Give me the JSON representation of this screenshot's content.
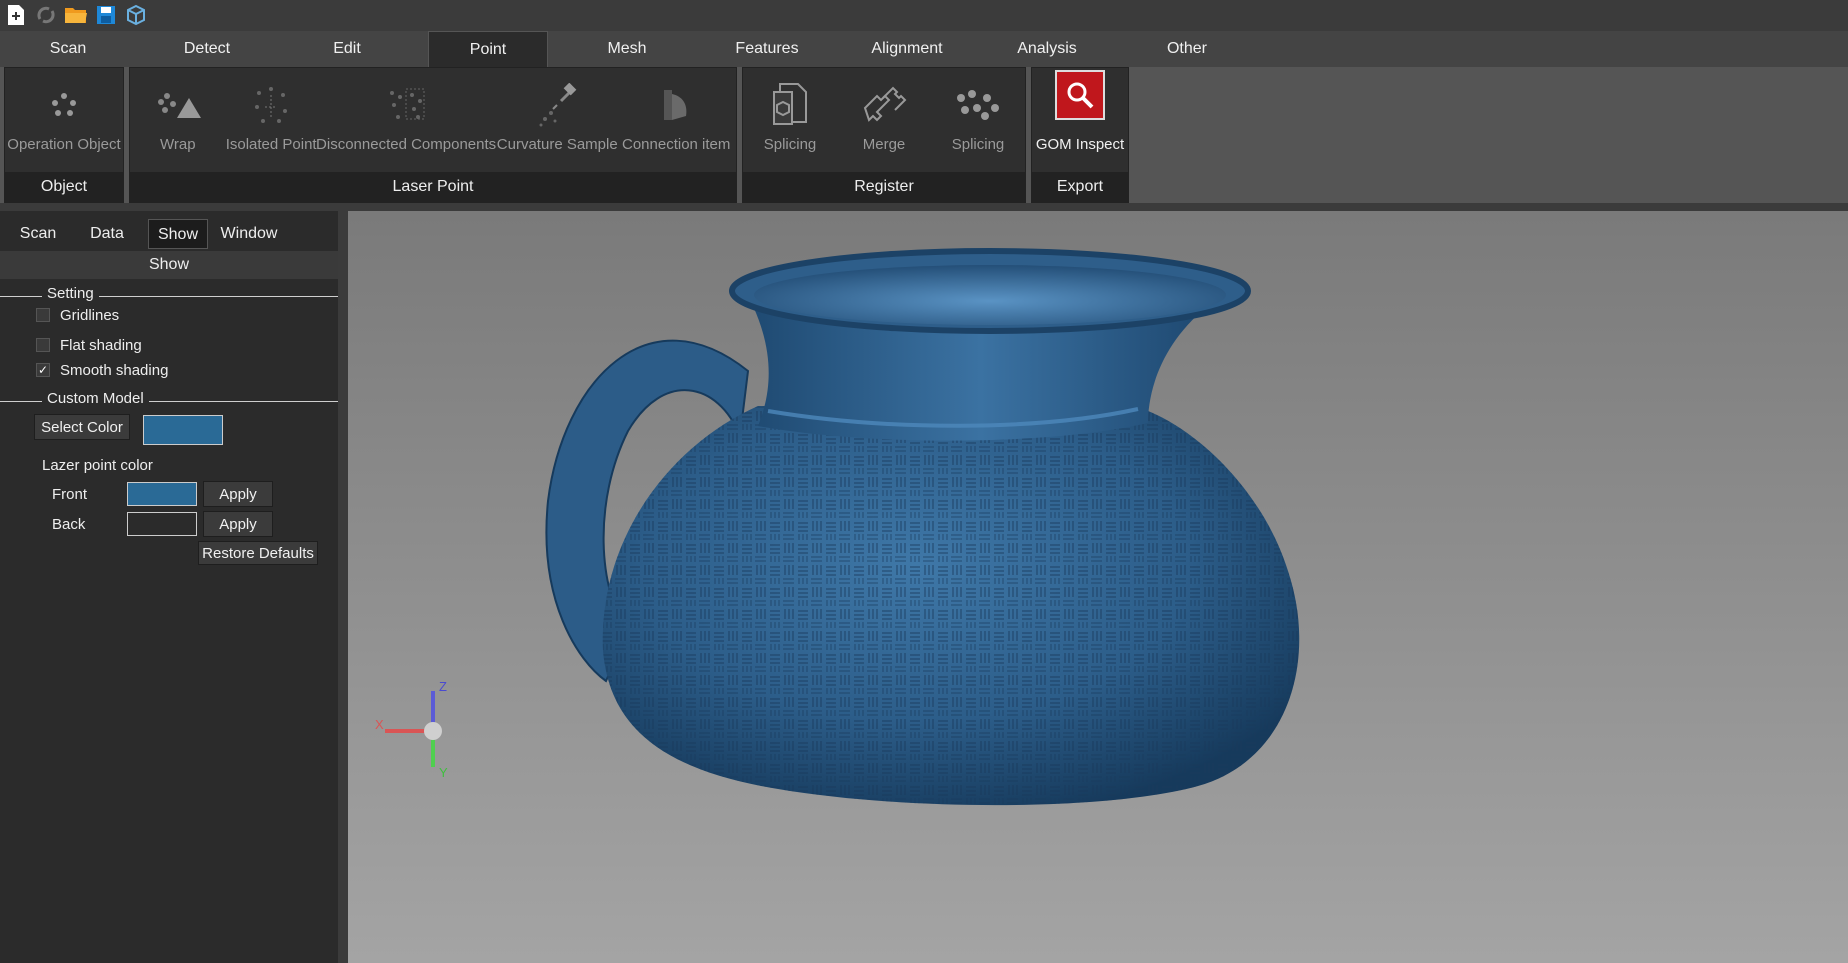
{
  "menu": {
    "tabs": [
      "Scan",
      "Detect",
      "Edit",
      "Point",
      "Mesh",
      "Features",
      "Alignment",
      "Analysis",
      "Other"
    ],
    "active": "Point"
  },
  "ribbon": {
    "object_group": {
      "label": "Object",
      "tools": {
        "operation_object": "Operation Object"
      }
    },
    "laser_group": {
      "label": "Laser Point",
      "tools": {
        "wrap": "Wrap",
        "isolated": "Isolated Point",
        "disconnected": "Disconnected Components",
        "curvature": "Curvature Sample",
        "connection": "Connection item"
      }
    },
    "register_group": {
      "label": "Register",
      "tools": {
        "splicing1": "Splicing",
        "merge": "Merge",
        "splicing2": "Splicing"
      }
    },
    "export_group": {
      "label": "Export",
      "tools": {
        "gom": "GOM Inspect"
      }
    }
  },
  "panel": {
    "tabs": [
      "Scan",
      "Data",
      "Show",
      "Window"
    ],
    "active_tab": "Show",
    "show_header": "Show",
    "setting": {
      "title": "Setting",
      "gridlines": "Gridlines",
      "flat": "Flat shading",
      "smooth": "Smooth shading",
      "smooth_check": "✓"
    },
    "custom": {
      "title": "Custom Model",
      "select_color": "Select Color",
      "lazer_title": "Lazer point color",
      "front": "Front",
      "back": "Back",
      "apply": "Apply",
      "restore": "Restore Defaults"
    }
  },
  "axes": {
    "x": "X",
    "y": "Y",
    "z": "Z"
  },
  "colors": {
    "model": "#2f5f8a",
    "swatch_custom": "#2a6a96",
    "swatch_front": "#2a6a96",
    "swatch_back": "#ffffff",
    "gom_red": "#c0171c"
  }
}
